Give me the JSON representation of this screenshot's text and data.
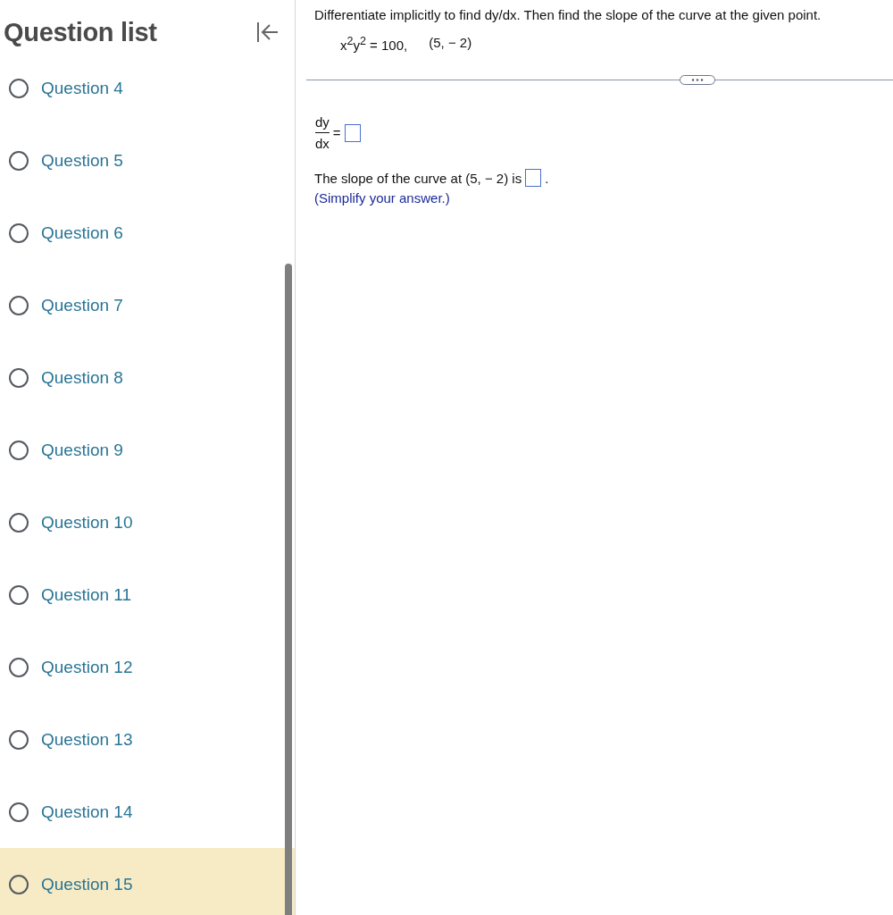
{
  "sidebar": {
    "title": "Question list",
    "items": [
      {
        "label": "Question 4",
        "selected": false
      },
      {
        "label": "Question 5",
        "selected": false
      },
      {
        "label": "Question 6",
        "selected": false
      },
      {
        "label": "Question 7",
        "selected": false
      },
      {
        "label": "Question 8",
        "selected": false
      },
      {
        "label": "Question 9",
        "selected": false
      },
      {
        "label": "Question 10",
        "selected": false
      },
      {
        "label": "Question 11",
        "selected": false
      },
      {
        "label": "Question 12",
        "selected": false
      },
      {
        "label": "Question 13",
        "selected": false
      },
      {
        "label": "Question 14",
        "selected": false
      },
      {
        "label": "Question 15",
        "selected": true
      }
    ]
  },
  "question": {
    "prompt": "Differentiate implicitly to find dy/dx. Then find the slope of the curve at the given point.",
    "equation": "x$^{2}$y$^{2}$ = 100,",
    "point": "(5, − 2)",
    "derivative": {
      "numerator": "dy",
      "denominator": "dx",
      "equals": "="
    },
    "slope": {
      "text": "The slope of the curve at (5, − 2) is",
      "end": "."
    },
    "hint": "(Simplify your answer.)"
  }
}
